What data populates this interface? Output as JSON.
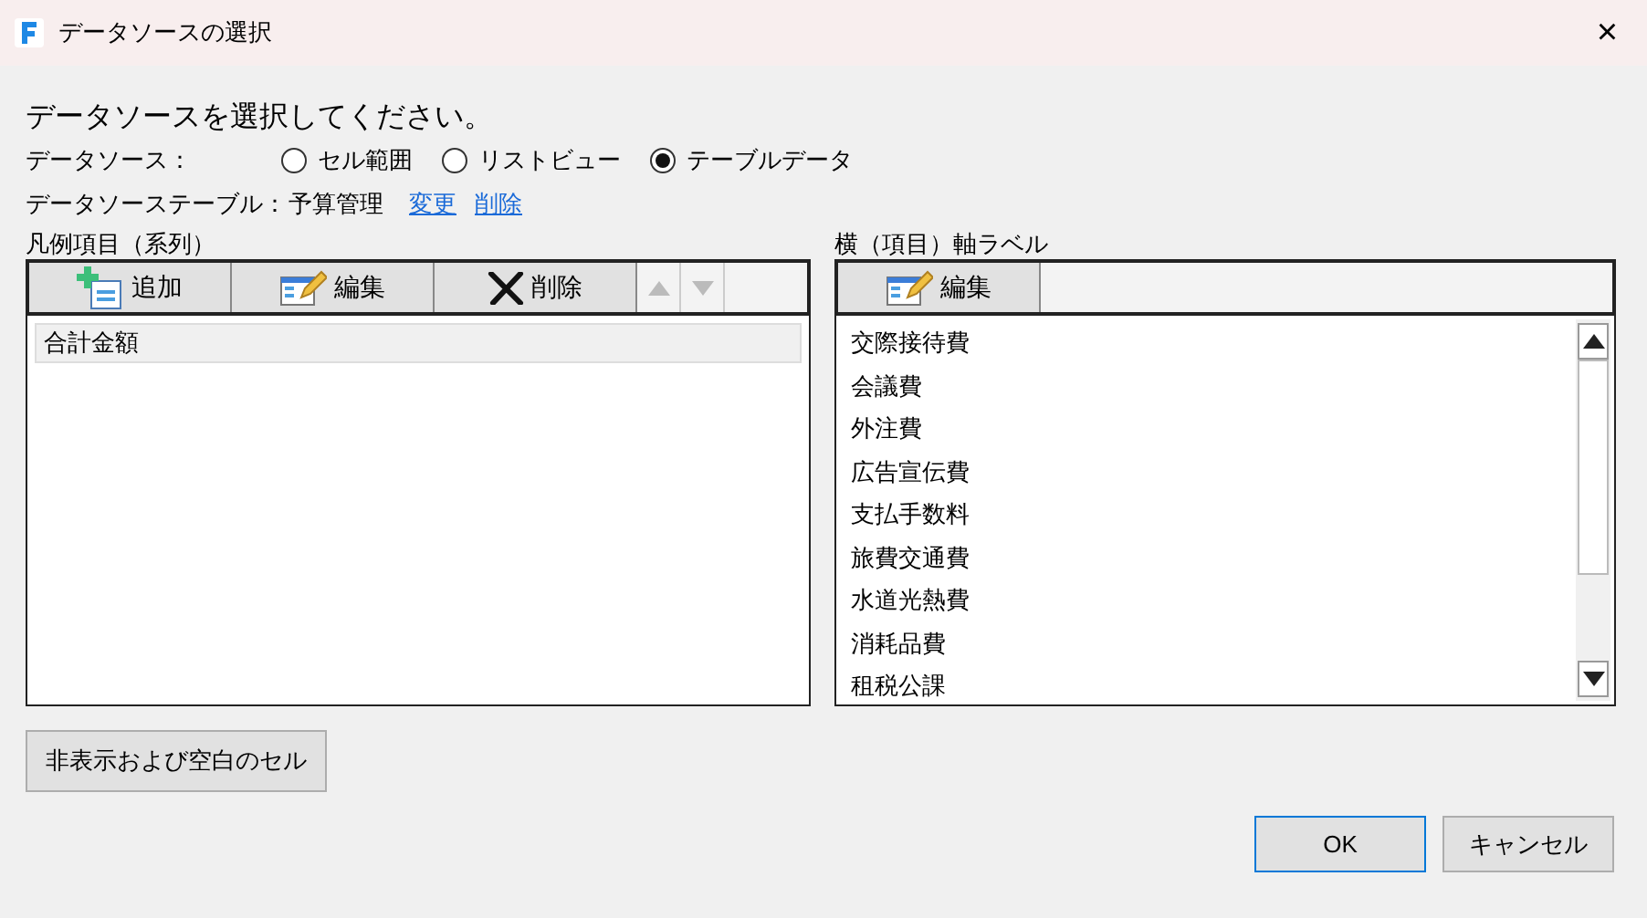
{
  "window": {
    "title": "データソースの選択",
    "close": "×"
  },
  "instruction": "データソースを選択してください。",
  "source": {
    "label": "データソース：",
    "options": [
      {
        "label": "セル範囲",
        "selected": false
      },
      {
        "label": "リストビュー",
        "selected": false
      },
      {
        "label": "テーブルデータ",
        "selected": true
      }
    ]
  },
  "source_table": {
    "label": "データソーステーブル：",
    "value": "予算管理",
    "links": [
      "変更",
      "削除"
    ]
  },
  "series_panel": {
    "title": "凡例項目（系列）",
    "toolbar": [
      {
        "kind": "add",
        "label": "追加",
        "disabled": false
      },
      {
        "kind": "edit",
        "label": "編集",
        "disabled": false
      },
      {
        "kind": "delete",
        "label": "削除",
        "disabled": false
      },
      {
        "kind": "up",
        "disabled": true
      },
      {
        "kind": "down",
        "disabled": true
      }
    ],
    "items": [
      {
        "label": "合計金額",
        "selected": true
      }
    ]
  },
  "axis_panel": {
    "title": "横（項目）軸ラベル",
    "toolbar": [
      {
        "kind": "edit",
        "label": "編集",
        "disabled": false
      }
    ],
    "items": [
      "交際接待費",
      "会議費",
      "外注費",
      "広告宣伝費",
      "支払手数料",
      "旅費交通費",
      "水道光熱費",
      "消耗品費",
      "租税公課"
    ]
  },
  "hidden_cells_button": "非表示および空白のセル",
  "buttons": [
    {
      "label": "OK",
      "kind": "default"
    },
    {
      "label": "キャンセル",
      "kind": "normal"
    }
  ]
}
